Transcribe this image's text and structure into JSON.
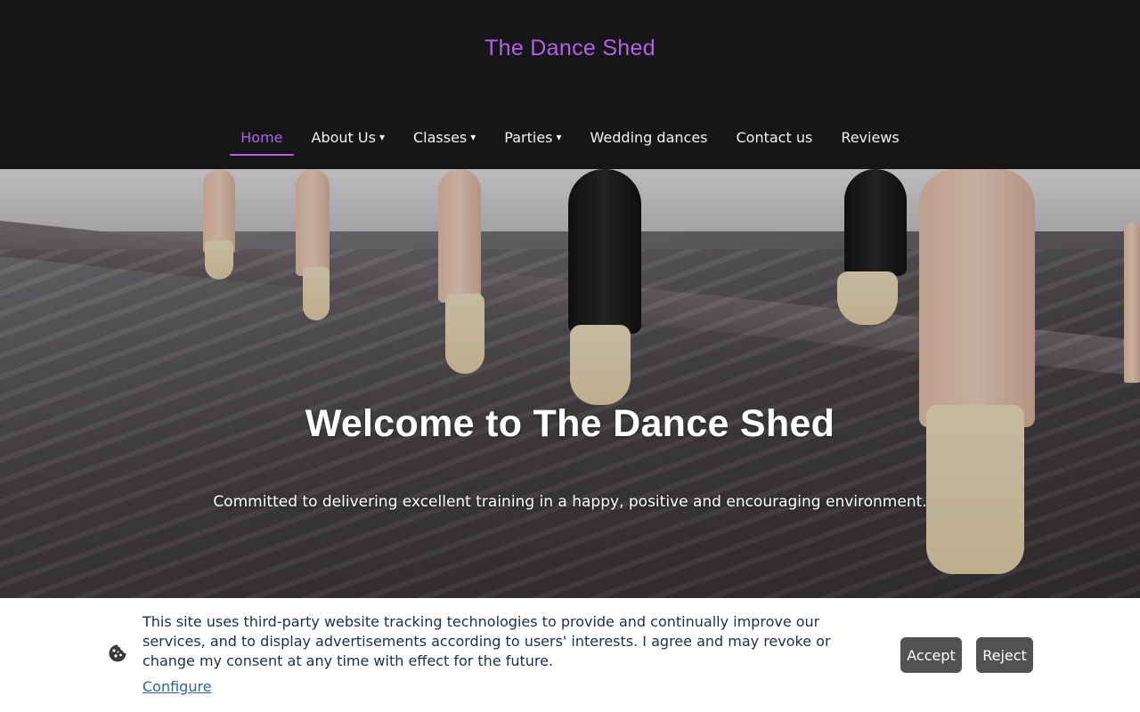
{
  "site": {
    "logo": "The Dance Shed",
    "accent_color": "#b55dee"
  },
  "nav": {
    "items": [
      {
        "label": "Home",
        "active": true,
        "dropdown": false
      },
      {
        "label": "About Us",
        "active": false,
        "dropdown": true
      },
      {
        "label": "Classes",
        "active": false,
        "dropdown": true
      },
      {
        "label": "Parties",
        "active": false,
        "dropdown": true
      },
      {
        "label": "Wedding dances",
        "active": false,
        "dropdown": false
      },
      {
        "label": "Contact us",
        "active": false,
        "dropdown": false
      },
      {
        "label": "Reviews",
        "active": false,
        "dropdown": false
      }
    ],
    "caret_glyph": "▾"
  },
  "hero": {
    "title": "Welcome to The Dance Shed",
    "subtitle": "Committed to delivering excellent training in a happy, positive and encouraging environment."
  },
  "cookie_banner": {
    "icon": "cookie-icon",
    "text": "This site uses third-party website tracking technologies to provide and continually improve our services, and to display advertisements according to users' interests. I agree and may revoke or change my consent at any time with effect for the future.",
    "configure_label": "Configure",
    "accept_label": "Accept",
    "reject_label": "Reject"
  }
}
